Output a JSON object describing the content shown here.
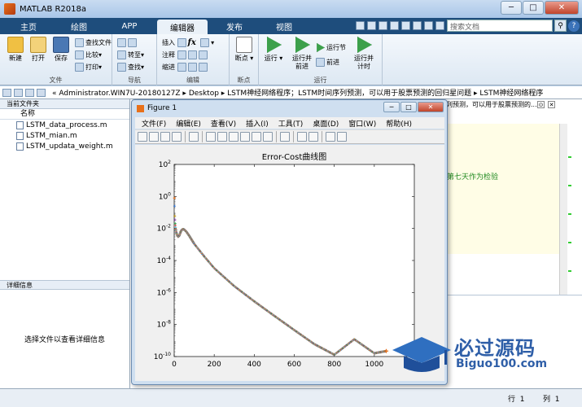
{
  "window": {
    "title": "MATLAB R2018a"
  },
  "tabs": [
    {
      "label": "主页",
      "active": false
    },
    {
      "label": "绘图",
      "active": false
    },
    {
      "label": "APP",
      "active": false
    },
    {
      "label": "编辑器",
      "active": true
    },
    {
      "label": "发布",
      "active": false
    },
    {
      "label": "视图",
      "active": false
    }
  ],
  "search": {
    "placeholder": "搜索文档"
  },
  "ribbon": {
    "file_group": "文件",
    "nav_group": "导航",
    "edit_group": "编辑",
    "breakpoint_group": "断点",
    "run_group": "运行",
    "new": "新建",
    "open": "打开",
    "save": "保存",
    "find_files": "查找文件",
    "compare": "比较",
    "print": "打印",
    "goto": "转至",
    "find": "查找",
    "insert": "插入",
    "fx": "fx",
    "comment": "注释",
    "indent": "缩进",
    "breakpoints": "断点",
    "run": "运行",
    "run_advance_1": "运行并",
    "run_advance_2": "前进",
    "run_section": "运行节",
    "advance": "前进",
    "run_time_1": "运行并",
    "run_time_2": "计时"
  },
  "address": {
    "path": "« Administrator.WIN7U-20180127Z ▸ Desktop ▸ LSTM神经网络程序；LSTM时间序列预测，可以用于股票预测的回归星问题 ▸ LSTM神经网络程序"
  },
  "current_folder": {
    "header": "当前文件夹",
    "col_name": "名称",
    "files": [
      "LSTM_data_process.m",
      "LSTM_mian.m",
      "LSTM_updata_weight.m"
    ]
  },
  "details": {
    "header": "详细信息",
    "message": "选择文件以查看详细信息"
  },
  "editor": {
    "tab_text": "列预测，可以用于股票预测的...",
    "comment": "第七天作为检验"
  },
  "status": {
    "row_label": "行",
    "row": "1",
    "col_label": "列",
    "col": "1"
  },
  "figure": {
    "title": "Figure 1",
    "menu": [
      "文件(F)",
      "编辑(E)",
      "查看(V)",
      "插入(I)",
      "工具(T)",
      "桌面(D)",
      "窗口(W)",
      "帮助(H)"
    ]
  },
  "watermark": {
    "main": "必过源码",
    "sub": "Biguo100.com"
  },
  "chart_data": {
    "type": "scatter",
    "title": "Error-Cost曲线图",
    "xlabel": "",
    "ylabel": "",
    "x_scale": "linear",
    "y_scale": "log",
    "xlim": [
      0,
      1200
    ],
    "ylim": [
      1e-10,
      100
    ],
    "xticks": [
      0,
      200,
      400,
      600,
      800,
      1000,
      1200
    ],
    "yticks": [
      "10^2",
      "10^0",
      "10^-2",
      "10^-4",
      "10^-6",
      "10^-8",
      "10^-10"
    ],
    "grid": false,
    "points": [
      [
        1,
        0.8
      ],
      [
        2,
        0.25
      ],
      [
        3,
        0.06
      ],
      [
        5,
        0.02
      ],
      [
        8,
        0.009
      ],
      [
        12,
        0.005
      ],
      [
        16,
        0.0035
      ],
      [
        20,
        0.003
      ],
      [
        25,
        0.0035
      ],
      [
        30,
        0.005
      ],
      [
        35,
        0.0075
      ],
      [
        40,
        0.0085
      ],
      [
        45,
        0.009
      ],
      [
        50,
        0.0085
      ],
      [
        60,
        0.0065
      ],
      [
        75,
        0.0035
      ],
      [
        100,
        0.0011
      ],
      [
        150,
        0.00018
      ],
      [
        200,
        3.3e-05
      ],
      [
        300,
        2.5e-06
      ],
      [
        400,
        2.8e-07
      ],
      [
        500,
        3.5e-08
      ],
      [
        600,
        4.5e-09
      ],
      [
        700,
        6e-10
      ],
      [
        800,
        1.3e-10
      ],
      [
        900,
        1.2e-09
      ],
      [
        1000,
        1.6e-10
      ],
      [
        1060,
        2.2e-10
      ]
    ]
  }
}
